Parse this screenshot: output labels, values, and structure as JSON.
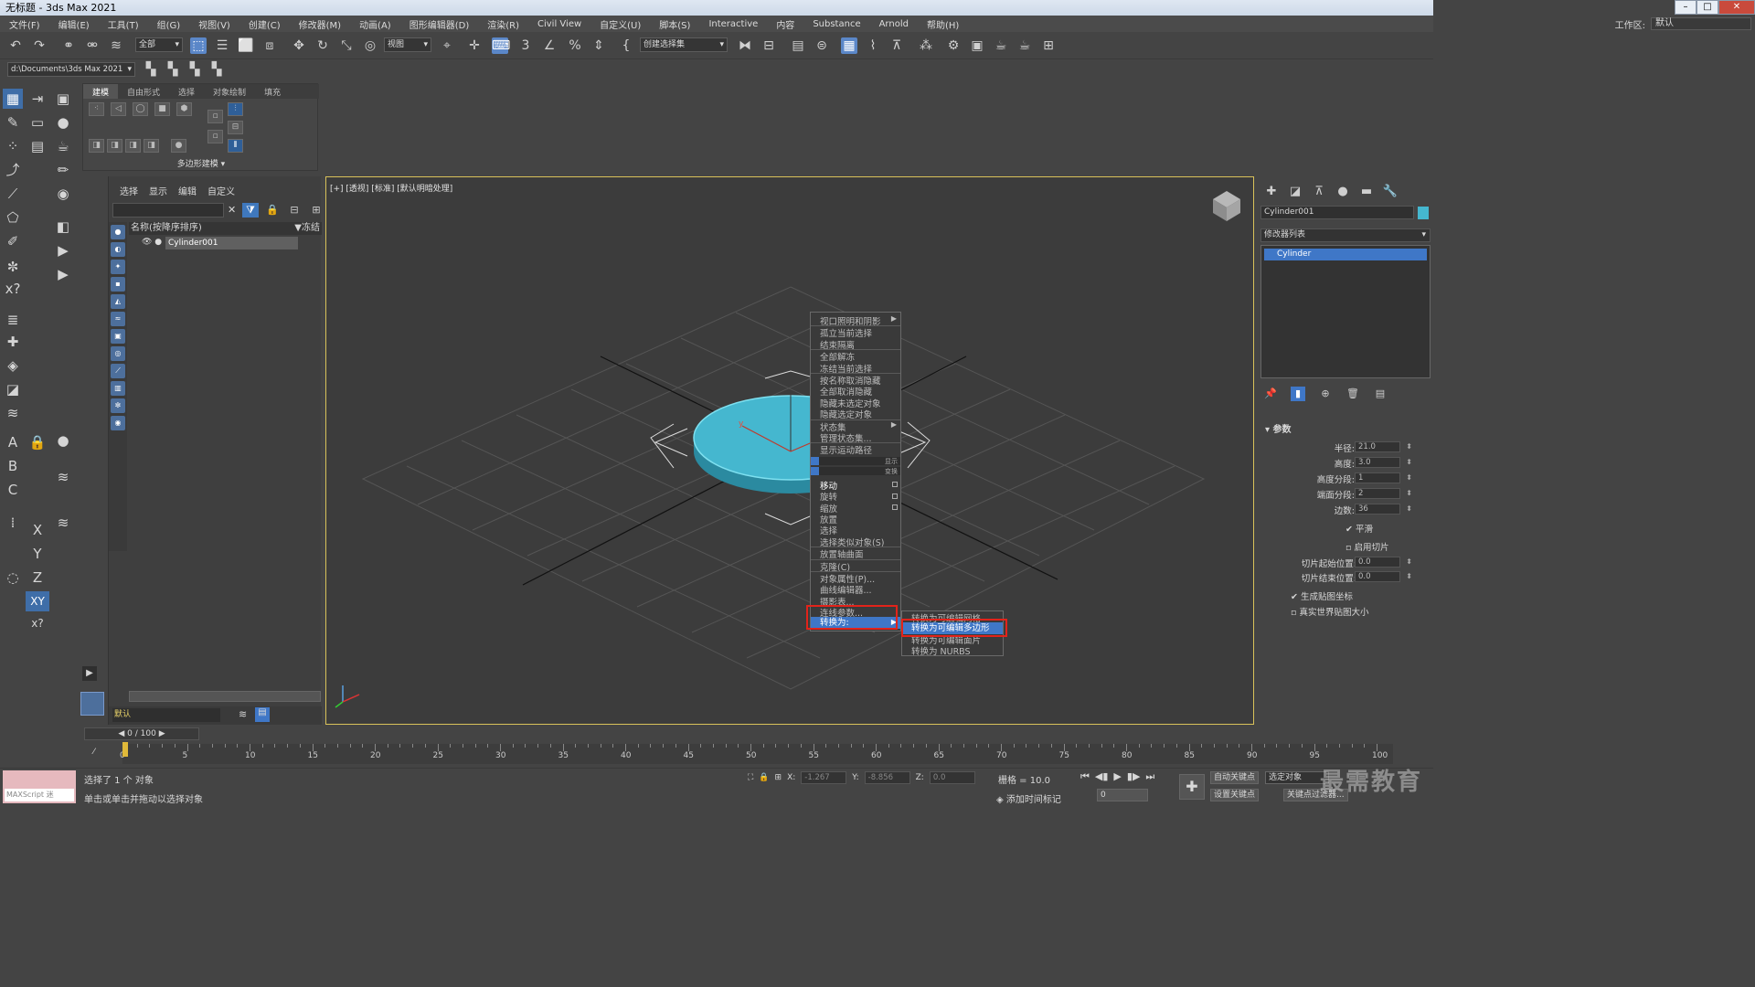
{
  "title_bar": {
    "title": "无标题 - 3ds Max 2021"
  },
  "menu": [
    "文件(F)",
    "编辑(E)",
    "工具(T)",
    "组(G)",
    "视图(V)",
    "创建(C)",
    "修改器(M)",
    "动画(A)",
    "图形编辑器(D)",
    "渲染(R)",
    "Civil View",
    "自定义(U)",
    "脚本(S)",
    "Interactive",
    "内容",
    "Substance",
    "Arnold",
    "帮助(H)"
  ],
  "workspace": {
    "label": "工作区:",
    "value": "默认"
  },
  "toolbar": {
    "selection_filter": "全部",
    "ref_coord": "视图",
    "named_selection": "创建选择集"
  },
  "project_path": "d:\\Documents\\3ds Max 2021",
  "ribbon": {
    "tabs": [
      "建模",
      "自由形式",
      "选择",
      "对象绘制",
      "填充"
    ],
    "footer": "多边形建模"
  },
  "scene_explorer": {
    "tabs": [
      "选择",
      "显示",
      "编辑",
      "自定义"
    ],
    "column_name": "名称(按降序排序)",
    "column_freeze": "▼冻结",
    "objects": [
      "Cylinder001"
    ],
    "layer": "默认"
  },
  "viewport": {
    "label": "[+] [透视] [标准] [默认明暗处理]",
    "axis_label": "y"
  },
  "context_menu": {
    "display_items": [
      "视口照明和阴影",
      "孤立当前选择",
      "结束隔离",
      "全部解冻",
      "冻结当前选择",
      "按名称取消隐藏",
      "全部取消隐藏",
      "隐藏未选定对象",
      "隐藏选定对象",
      "状态集",
      "管理状态集...",
      "显示运动路径"
    ],
    "band_display": "显示",
    "band_transform": "变换",
    "transform_items": [
      "移动",
      "旋转",
      "缩放",
      "放置",
      "选择",
      "选择类似对象(S)",
      "放置轴曲面",
      "克隆(C)",
      "对象属性(P)...",
      "曲线编辑器...",
      "摄影表...",
      "连线参数...",
      "转换为:"
    ],
    "submenu": [
      "转换为可编辑网格",
      "转换为可编辑多边形",
      "转换为可编辑面片",
      "转换为 NURBS"
    ],
    "highlight": "转换为可编辑多边形"
  },
  "command_panel": {
    "object_name": "Cylinder001",
    "object_color": "#45b7cf",
    "modifier_list": "修改器列表",
    "stack": [
      "Cylinder"
    ],
    "rollout": "参数",
    "params": [
      {
        "label": "半径:",
        "value": "21.0"
      },
      {
        "label": "高度:",
        "value": "3.0"
      },
      {
        "label": "高度分段:",
        "value": "1"
      },
      {
        "label": "端面分段:",
        "value": "2"
      },
      {
        "label": "边数:",
        "value": "36"
      }
    ],
    "smooth": "平滑",
    "slice_on": "启用切片",
    "slice_from_label": "切片起始位置:",
    "slice_from": "0.0",
    "slice_to_label": "切片结束位置:",
    "slice_to": "0.0",
    "gen_map": "生成贴图坐标",
    "real_world": "真实世界贴图大小"
  },
  "timeline": {
    "frame": "0 / 100",
    "ticks": [
      "0",
      "5",
      "10",
      "15",
      "20",
      "25",
      "30",
      "35",
      "40",
      "45",
      "50",
      "55",
      "60",
      "65",
      "70",
      "75",
      "80",
      "85",
      "90",
      "95",
      "100"
    ]
  },
  "status": {
    "maxscript": "MAXScript 迷",
    "selected": "选择了 1 个 对象",
    "prompt": "单击或单击并拖动以选择对象",
    "x_label": "X:",
    "x": "-1.267",
    "y_label": "Y:",
    "y": "-8.856",
    "z_label": "Z:",
    "z": "0.0",
    "grid": "栅格 = 10.0",
    "add_time_tag": "添加时间标记",
    "auto_key": "自动关键点",
    "set_key": "设置关键点",
    "selected_obj": "选定对象",
    "key_filter": "关键点过滤器...",
    "frame_field": "0"
  },
  "watermark": "最需教育",
  "colors": {
    "highlight": "#3f77c7",
    "red_box": "#e2231a",
    "cylinder": "#45b7cf",
    "viewport_border": "#d9c25a"
  }
}
